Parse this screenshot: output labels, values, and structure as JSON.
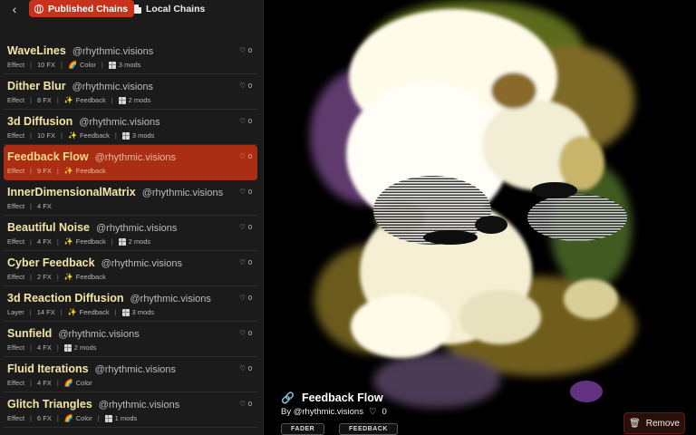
{
  "tabs": {
    "back_icon": "chevron-left-icon",
    "published": "Published Chains",
    "local": "Local Chains"
  },
  "chains": [
    {
      "name": "WaveLines",
      "author": "@rhythmic.visions",
      "type": "Effect",
      "fx": "10 FX",
      "tag": "Color",
      "tag_icon": "rainbow-icon",
      "mods": "3 mods",
      "likes": "0"
    },
    {
      "name": "Dither Blur",
      "author": "@rhythmic.visions",
      "type": "Effect",
      "fx": "8 FX",
      "tag": "Feedback",
      "tag_icon": "sparkle-icon",
      "mods": "2 mods",
      "likes": "0"
    },
    {
      "name": "3d Diffusion",
      "author": "@rhythmic.visions",
      "type": "Effect",
      "fx": "10 FX",
      "tag": "Feedback",
      "tag_icon": "sparkle-icon",
      "mods": "3 mods",
      "likes": "0"
    },
    {
      "name": "Feedback Flow",
      "author": "@rhythmic.visions",
      "type": "Effect",
      "fx": "9 FX",
      "tag": "Feedback",
      "tag_icon": "sparkle-icon",
      "mods": "",
      "likes": "0",
      "active": true
    },
    {
      "name": "InnerDimensionalMatrix",
      "author": "@rhythmic.visions",
      "type": "Effect",
      "fx": "4 FX",
      "tag": "",
      "mods": "",
      "likes": "0"
    },
    {
      "name": "Beautiful Noise",
      "author": "@rhythmic.visions",
      "type": "Effect",
      "fx": "4 FX",
      "tag": "Feedback",
      "tag_icon": "sparkle-icon",
      "mods": "2 mods",
      "likes": "0"
    },
    {
      "name": "Cyber Feedback",
      "author": "@rhythmic.visions",
      "type": "Effect",
      "fx": "2 FX",
      "tag": "Feedback",
      "tag_icon": "sparkle-icon",
      "mods": "",
      "likes": "0"
    },
    {
      "name": "3d Reaction Diffusion",
      "author": "@rhythmic.visions",
      "type": "Layer",
      "fx": "14 FX",
      "tag": "Feedback",
      "tag_icon": "sparkle-icon",
      "mods": "3 mods",
      "likes": "0"
    },
    {
      "name": "Sunfield",
      "author": "@rhythmic.visions",
      "type": "Effect",
      "fx": "4 FX",
      "tag": "",
      "mods": "2 mods",
      "likes": "0"
    },
    {
      "name": "Fluid Iterations",
      "author": "@rhythmic.visions",
      "type": "Effect",
      "fx": "4 FX",
      "tag": "Color",
      "tag_icon": "rainbow-icon",
      "mods": "",
      "likes": "0"
    },
    {
      "name": "Glitch Triangles",
      "author": "@rhythmic.visions",
      "type": "Effect",
      "fx": "6 FX",
      "tag": "Color",
      "tag_icon": "rainbow-icon",
      "mods": "1 mods",
      "likes": "0"
    }
  ],
  "preview": {
    "title": "Feedback Flow",
    "title_icon": "link-icon",
    "author": "By @rhythmic.visions",
    "likes": "0",
    "chips": [
      "FADER",
      "FEEDBACK"
    ],
    "remove_label": "Remove"
  },
  "colors": {
    "accent": "#c8321a",
    "active_row": "#a92e13",
    "title_text": "#f4e7a6"
  }
}
